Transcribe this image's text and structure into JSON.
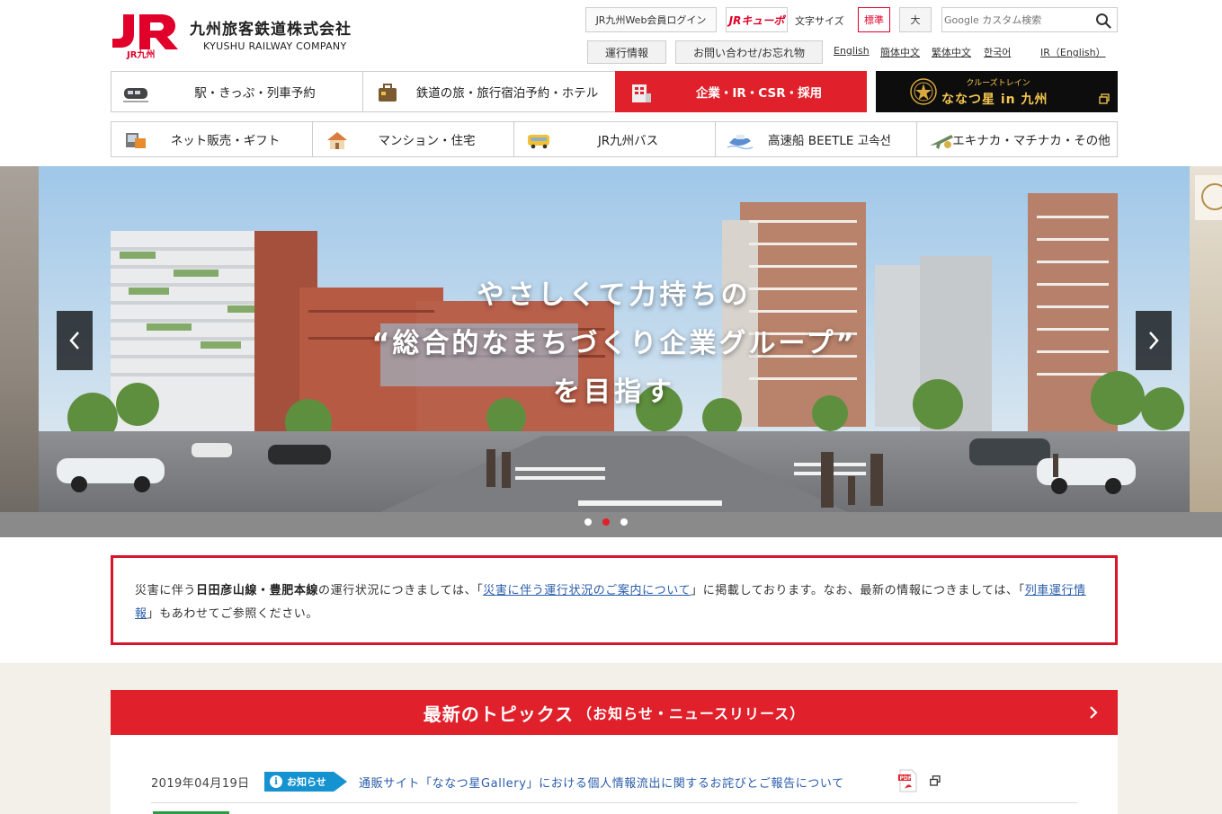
{
  "header": {
    "logo_name": "九州旅客鉄道株式会社",
    "logo_en": "KYUSHU RAILWAY COMPANY",
    "logo_mark_text": "JR九州",
    "login_label": "JR九州Web会員ログイン",
    "jrq_label": "JRキューポ",
    "font_size_label": "文字サイズ",
    "font_std": "標準",
    "font_large": "大",
    "search_placeholder": "Google カスタム検索",
    "operation_info": "運行情報",
    "contact": "お問い合わせ/お忘れ物",
    "languages": [
      "English",
      "簡体中文",
      "繁体中文",
      "한국어",
      "IR（English）"
    ]
  },
  "nav_primary": [
    {
      "label": "駅・きっぷ・列車予約",
      "icon": "train-icon"
    },
    {
      "label": "鉄道の旅・旅行宿泊予約・ホテル",
      "icon": "suitcase-icon"
    },
    {
      "label": "企業・IR・CSR・採用",
      "icon": "building-icon",
      "active": true
    },
    {
      "label": "ななつ星 in 九州",
      "sub": "クルーズトレイン",
      "icon": "nanatsuboshi-emblem-icon"
    }
  ],
  "nav_secondary": [
    {
      "label": "ネット販売・ギフト",
      "icon": "shopping-icon"
    },
    {
      "label": "マンション・住宅",
      "icon": "house-icon"
    },
    {
      "label": "JR九州バス",
      "icon": "bus-icon"
    },
    {
      "label": "高速船 BEETLE 고속선",
      "icon": "ship-icon"
    },
    {
      "label": "エキナカ・マチナカ・その他",
      "icon": "plane-icon"
    }
  ],
  "hero": {
    "line1": "やさしくて力持ちの",
    "line2": "“総合的なまちづくり企業グループ”",
    "line3": "を目指す",
    "slides": 3,
    "active_slide": 2
  },
  "notice": {
    "p1": "災害に伴う",
    "lines": "日田彦山線・豊肥本線",
    "p2": "の運行状況につきましては、「",
    "link1": "災害に伴う運行状況のご案内について",
    "p3": "」に掲載しております。なお、最新の情報につきましては、「",
    "link2": "列車運行情報",
    "p4": "」もあわせてご参照ください。"
  },
  "topics": {
    "title": "最新のトピックス",
    "subtitle": "（お知らせ・ニュースリリース）",
    "items": [
      {
        "date": "2019年04月19日",
        "badge": "お知らせ",
        "title": "通販サイト「ななつ星Gallery」における個人情報流出に関するお詫びとご報告について"
      }
    ]
  },
  "colors": {
    "brand_red": "#e0202a",
    "notice_border": "#d7152b",
    "link_blue": "#2a5caa",
    "badge_blue": "#1593d1",
    "nanatsu_gold": "#f5c750"
  }
}
